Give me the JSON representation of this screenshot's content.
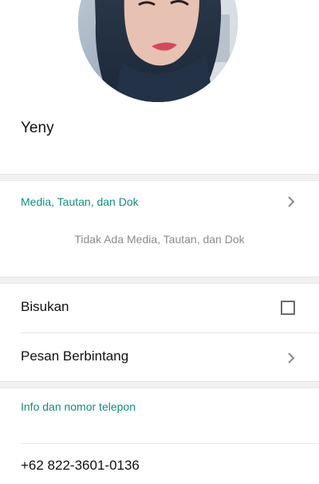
{
  "profile": {
    "name": "Yeny"
  },
  "media": {
    "title": "Media, Tautan, dan Dok",
    "empty_text": "Tidak Ada Media, Tautan, dan Dok"
  },
  "settings": {
    "mute_label": "Bisukan",
    "mute_checked": false,
    "starred_label": "Pesan Berbintang"
  },
  "info": {
    "title": "Info dan nomor telepon",
    "phone": "+62 822-3601-0136"
  },
  "colors": {
    "accent": "#128c7e",
    "muted_text": "#8c8c8c",
    "primary_text": "#111111",
    "divider": "#e6e6e6",
    "section_gap": "#f1f1f1"
  },
  "icons": {
    "media_chevron": "chevron-right-icon",
    "starred_chevron": "chevron-right-icon",
    "mute_checkbox": "checkbox-icon"
  }
}
